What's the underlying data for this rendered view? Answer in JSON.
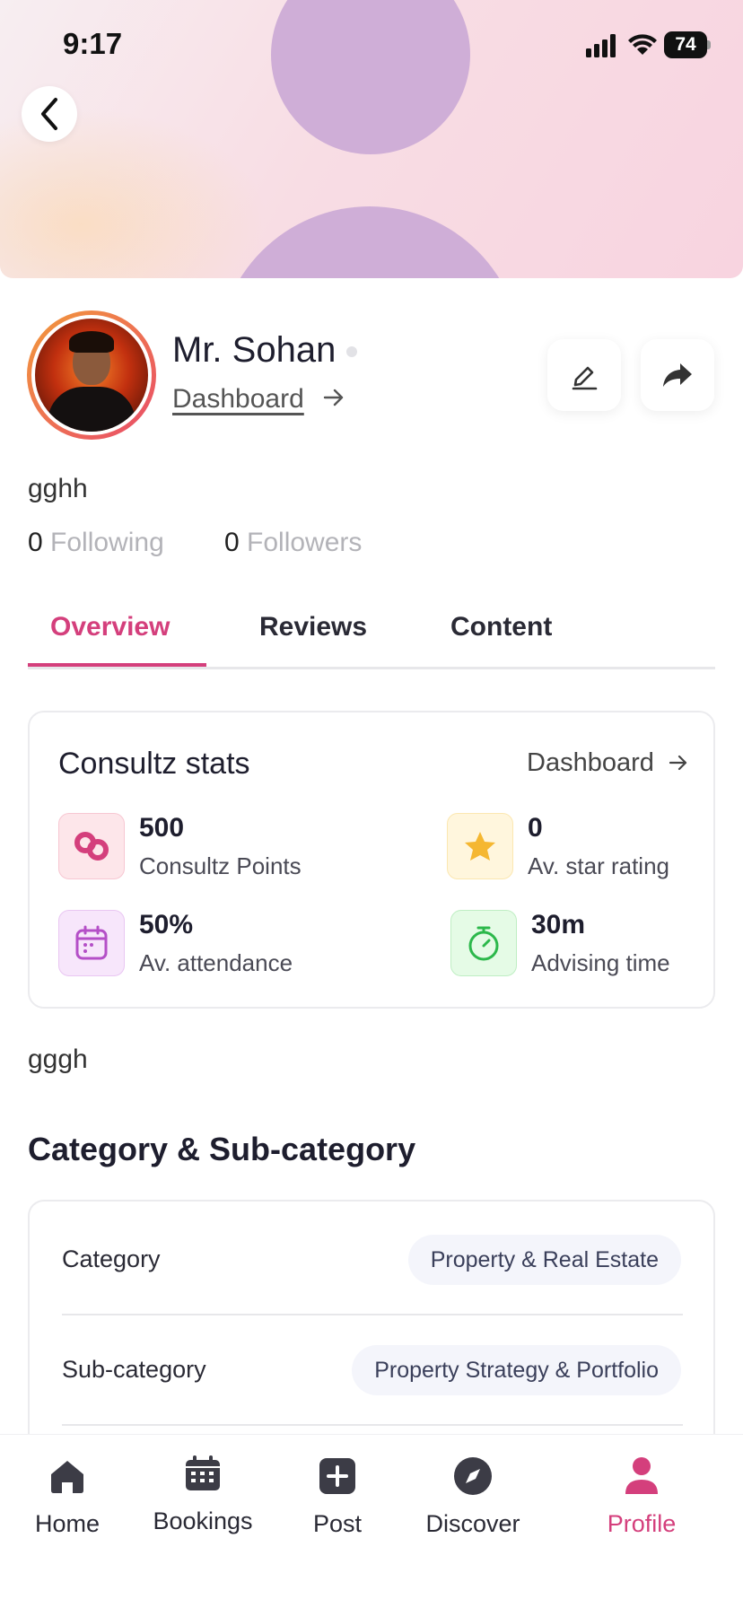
{
  "status_bar": {
    "time": "9:17",
    "battery": "74"
  },
  "profile": {
    "name": "Mr. Sohan",
    "dashboard_link": "Dashboard",
    "bio": "gghh",
    "following_count": "0",
    "following_label": "Following",
    "followers_count": "0",
    "followers_label": "Followers"
  },
  "tabs": [
    {
      "label": "Overview",
      "active": true
    },
    {
      "label": "Reviews",
      "active": false
    },
    {
      "label": "Content",
      "active": false
    }
  ],
  "stats": {
    "title": "Consultz stats",
    "dashboard_link": "Dashboard",
    "items": [
      {
        "value": "500",
        "label": "Consultz Points",
        "icon": "consultz-logo-icon",
        "color": "#d43f7c"
      },
      {
        "value": "0",
        "label": "Av. star rating",
        "icon": "star-icon",
        "color": "#f5b731"
      },
      {
        "value": "50%",
        "label": "Av. attendance",
        "icon": "calendar-icon",
        "color": "#b44fc7"
      },
      {
        "value": "30m",
        "label": "Advising time",
        "icon": "stopwatch-icon",
        "color": "#2cb84b"
      }
    ]
  },
  "about_text": "gggh",
  "category_section": {
    "title": "Category & Sub-category",
    "rows": [
      {
        "label": "Category",
        "value": "Property & Real Estate"
      },
      {
        "label": "Sub-category",
        "value": "Property Strategy & Portfolio"
      }
    ]
  },
  "bottom_nav": [
    {
      "label": "Home",
      "icon": "home-icon",
      "active": false
    },
    {
      "label": "Bookings",
      "icon": "calendar-icon",
      "active": false
    },
    {
      "label": "Post",
      "icon": "plus-square-icon",
      "active": false
    },
    {
      "label": "Discover",
      "icon": "compass-icon",
      "active": false
    },
    {
      "label": "Profile",
      "icon": "profile-icon",
      "active": true
    }
  ],
  "colors": {
    "accent": "#d43f7c",
    "muted": "#b3b3b8"
  }
}
